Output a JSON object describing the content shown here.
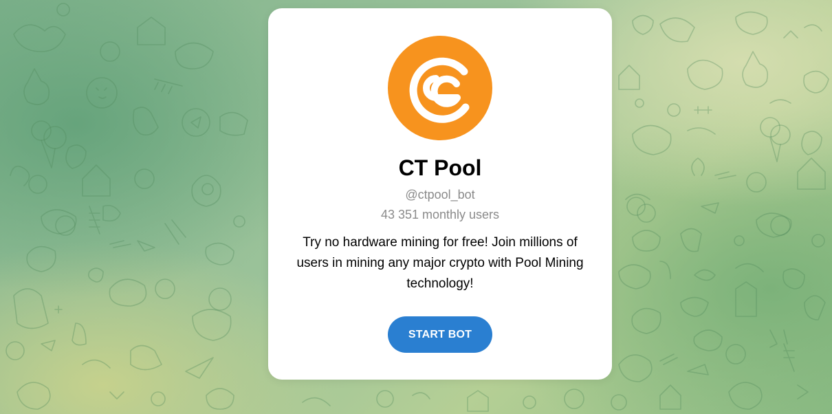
{
  "bot": {
    "name": "CT Pool",
    "username": "@ctpool_bot",
    "monthly_users": "43 351 monthly users",
    "description": "Try no hardware mining for free! Join millions of users in mining any major crypto with Pool Mining technology!",
    "avatar_icon": "ct-pool-logo-icon",
    "avatar_color": "#f7931e"
  },
  "actions": {
    "start_label": "START BOT",
    "start_color": "#2a7fd1"
  },
  "background": {
    "pattern_icon": "doodle-pattern-background"
  }
}
